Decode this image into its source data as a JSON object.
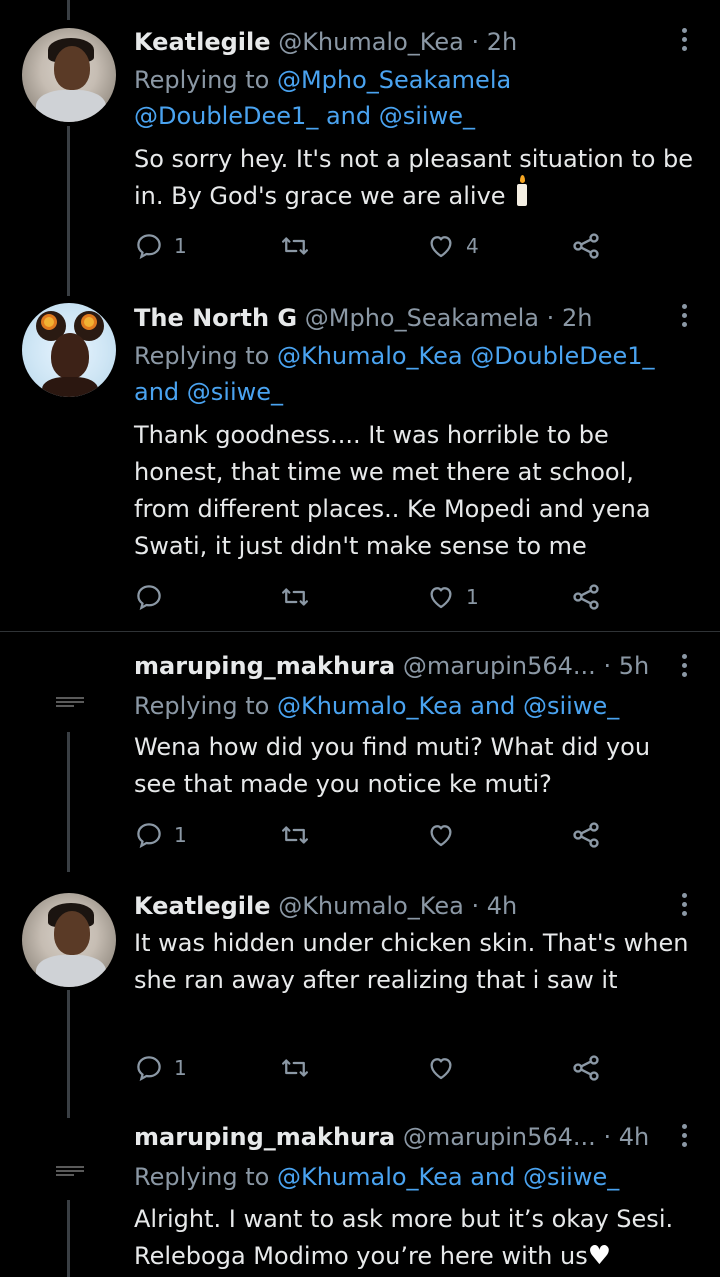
{
  "tweets": [
    {
      "name": "Keatlegile",
      "handle": "@Khumalo_Kea",
      "dot": "·",
      "time": "2h",
      "replying_prefix": "Replying to",
      "mentions_line1": "@Mpho_Seakamela",
      "mentions_line2": "@DoubleDee1_ and @siiwe_",
      "body": "So sorry hey. It's not a pleasant situation to be in. By God's grace we are alive",
      "emoji": "candle",
      "reply_count": "1",
      "retweet_count": "",
      "like_count": "4"
    },
    {
      "name": "The North G",
      "handle": "@Mpho_Seakamela",
      "dot": "·",
      "time": "2h",
      "replying_prefix": "Replying to",
      "mentions_line1": "@Khumalo_Kea @DoubleDee1_",
      "mentions_line2": "and @siiwe_",
      "body": "Thank goodness.... It was horrible to be honest, that time we met there at school, from different places.. Ke Mopedi and yena Swati, it just didn't make sense to me",
      "reply_count": "",
      "retweet_count": "",
      "like_count": "1"
    },
    {
      "name": "maruping_makhura",
      "handle": "@marupin564...",
      "dot": "·",
      "time": "5h",
      "replying_prefix": "Replying to",
      "mentions": "@Khumalo_Kea and @siiwe_",
      "body": "Wena how did you find muti? What did you see that made you notice ke muti?",
      "reply_count": "1",
      "retweet_count": "",
      "like_count": ""
    },
    {
      "name": "Keatlegile",
      "handle": "@Khumalo_Kea",
      "dot": "·",
      "time": "4h",
      "body": "It was hidden under chicken skin. That's when she ran away after realizing that i saw it",
      "reply_count": "1",
      "retweet_count": "",
      "like_count": ""
    },
    {
      "name": "maruping_makhura",
      "handle": "@marupin564...",
      "dot": "·",
      "time": "4h",
      "replying_prefix": "Replying to",
      "mentions": "@Khumalo_Kea and @siiwe_",
      "body": "Alright. I want to ask more but it’s okay Sesi. Releboga Modimo you’re here with us",
      "emoji": "white-heart"
    }
  ],
  "colors": {
    "background": "#000000",
    "text": "#e7e9ea",
    "muted": "#8b98a5",
    "link": "#4aa3f0",
    "divider": "#2f3336"
  }
}
